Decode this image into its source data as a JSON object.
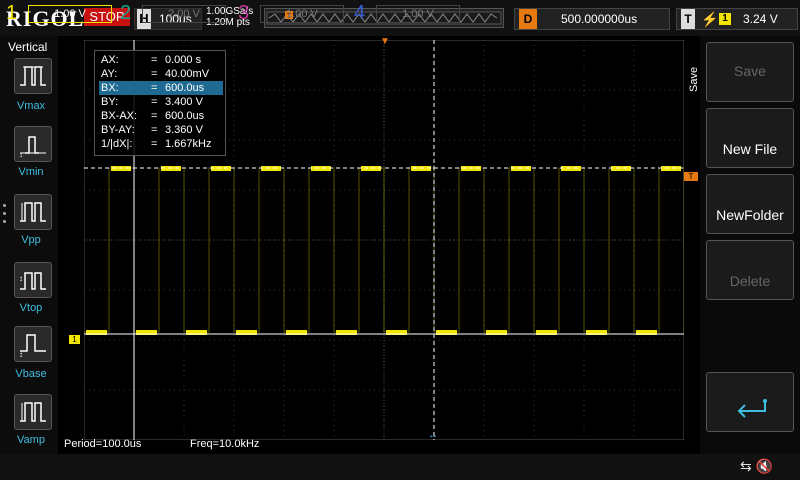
{
  "header": {
    "brand": "RIGOL",
    "run_state": "STOP",
    "horizontal_key": "H",
    "timebase": "100us",
    "sample_rate": "1.00GSa/s",
    "memory_depth": "1.20M pts",
    "delay_key": "D",
    "delay": "500.000000us",
    "trigger_key": "T",
    "trigger_edge": "rising-edge-icon",
    "trigger_source": "1",
    "trigger_level": "3.24 V",
    "trigger_marker": "T"
  },
  "measure_panel": {
    "title": "Vertical",
    "items": [
      "Vmax",
      "Vmin",
      "Vpp",
      "Vtop",
      "Vbase",
      "Vamp"
    ]
  },
  "cursor_readout": {
    "rows": [
      {
        "key": "AX:",
        "value": "0.000 s"
      },
      {
        "key": "AY:",
        "value": "40.00mV"
      },
      {
        "key": "BX:",
        "value": "600.0us"
      },
      {
        "key": "BY:",
        "value": "3.400 V"
      },
      {
        "key": "BX-AX:",
        "value": "600.0us"
      },
      {
        "key": "BY-AY:",
        "value": "3.360 V"
      },
      {
        "key": "1/|dX|:",
        "value": "1.667kHz"
      }
    ],
    "highlight_row": 2,
    "eq": "="
  },
  "measurements": {
    "period": "Period=100.0us",
    "freq": "Freq=10.0kHz"
  },
  "channels": [
    {
      "num": "1",
      "scale": "1.00 V",
      "color": "#f2e600",
      "active": true
    },
    {
      "num": "2",
      "scale": "2.00 V",
      "color": "#1fa090",
      "active": false
    },
    {
      "num": "3",
      "scale": "1.00 V",
      "color": "#c0399a",
      "active": false
    },
    {
      "num": "4",
      "scale": "1.00 V",
      "color": "#3a5fd0",
      "active": false
    }
  ],
  "ch1_marker": "1",
  "softkeys": {
    "menu_title": "Save",
    "items": [
      {
        "label": "Save",
        "enabled": false
      },
      {
        "label": "New File",
        "enabled": true
      },
      {
        "label": "NewFolder",
        "enabled": true
      },
      {
        "label": "Delete",
        "enabled": false
      },
      {
        "label": "return-icon",
        "enabled": true
      }
    ]
  },
  "waveform": {
    "signal": "square",
    "frequency": "10.0kHz",
    "high_level": 3.4,
    "low_level": 0.04
  },
  "colors": {
    "ch1": "#f2e600",
    "trigger": "#e67a10",
    "stop": "#c81010",
    "highlight": "#1f6a92",
    "measure_label": "#3fbfe0"
  }
}
